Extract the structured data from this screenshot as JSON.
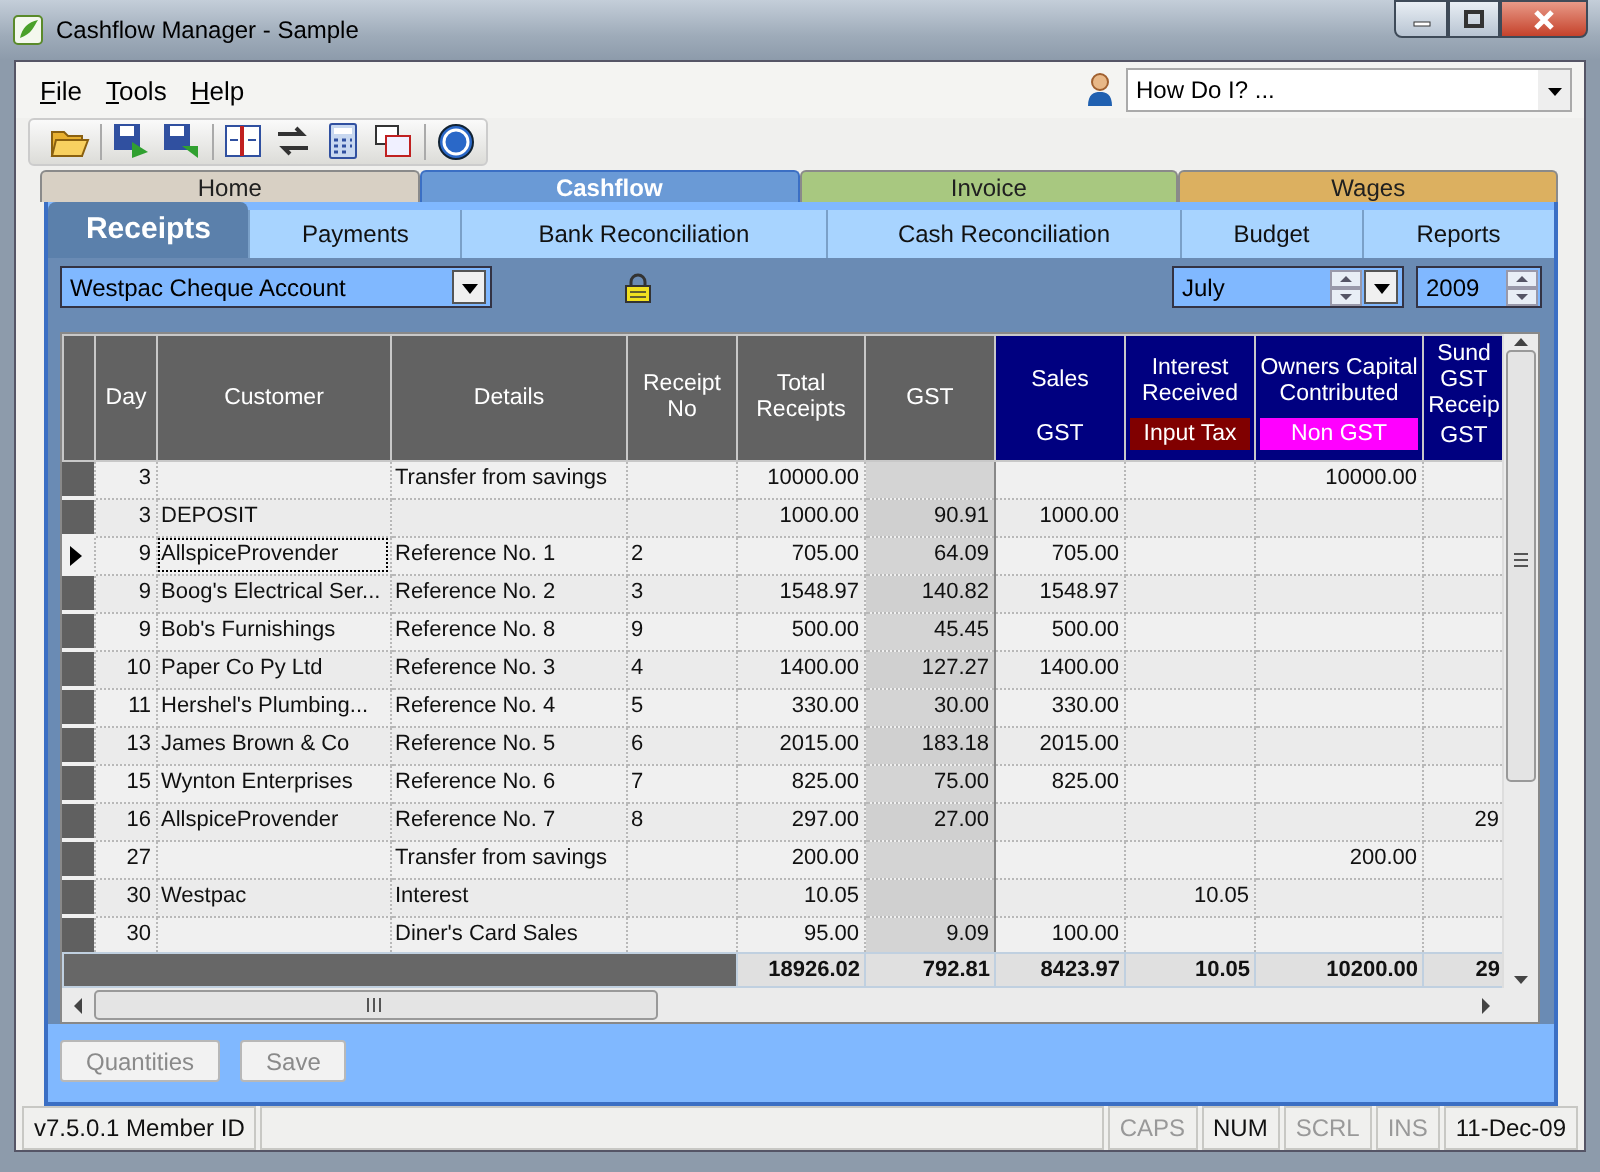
{
  "window": {
    "title": "Cashflow Manager - Sample",
    "menu": [
      "File",
      "Tools",
      "Help"
    ],
    "help_search": {
      "value": "How Do I? ..."
    }
  },
  "top_tabs": [
    {
      "label": "Home",
      "selected": false,
      "color": "#d8d0c4"
    },
    {
      "label": "Cashflow",
      "selected": true,
      "color": "#6a9ad6"
    },
    {
      "label": "Invoice",
      "selected": false,
      "color": "#a8c880"
    },
    {
      "label": "Wages",
      "selected": false,
      "color": "#dcb060"
    }
  ],
  "sub_tabs": [
    {
      "label": "Receipts",
      "selected": true
    },
    {
      "label": "Payments",
      "selected": false
    },
    {
      "label": "Bank Reconciliation",
      "selected": false
    },
    {
      "label": "Cash Reconciliation",
      "selected": false
    },
    {
      "label": "Budget",
      "selected": false
    },
    {
      "label": "Reports",
      "selected": false
    }
  ],
  "filters": {
    "account": "Westpac Cheque Account",
    "locked": true,
    "month": "July",
    "year": "2009"
  },
  "columns": [
    {
      "header": "Day",
      "kind": "day"
    },
    {
      "header": "Customer",
      "kind": "text"
    },
    {
      "header": "Details",
      "kind": "text"
    },
    {
      "header": "Receipt No",
      "kind": "text"
    },
    {
      "header": "Total Receipts",
      "kind": "amount"
    },
    {
      "header": "GST",
      "kind": "computed"
    },
    {
      "header": "Sales",
      "kind": "account",
      "tag": "GST"
    },
    {
      "header": "Interest Received",
      "kind": "account",
      "tag": "Input Tax",
      "color": "#800000"
    },
    {
      "header": "Owners Capital Contributed",
      "kind": "account",
      "tag": "Non GST",
      "color": "#ff00ff"
    },
    {
      "header": "Sund GST Receip",
      "kind": "account",
      "tag": "GST"
    }
  ],
  "rows": [
    {
      "selected": false,
      "cells": [
        "3",
        "",
        "Transfer from savings",
        "",
        "10000.00",
        "",
        "",
        "",
        "10000.00",
        ""
      ]
    },
    {
      "selected": false,
      "cells": [
        "3",
        "DEPOSIT",
        "",
        "",
        "1000.00",
        "90.91",
        "1000.00",
        "",
        "",
        ""
      ]
    },
    {
      "selected": true,
      "cells": [
        "9",
        "AllspiceProvender",
        "Reference No. 1",
        "2",
        "705.00",
        "64.09",
        "705.00",
        "",
        "",
        ""
      ]
    },
    {
      "selected": false,
      "cells": [
        "9",
        "Boog's Electrical Ser...",
        "Reference No. 2",
        "3",
        "1548.97",
        "140.82",
        "1548.97",
        "",
        "",
        ""
      ]
    },
    {
      "selected": false,
      "cells": [
        "9",
        "Bob's Furnishings",
        "Reference No. 8",
        "9",
        "500.00",
        "45.45",
        "500.00",
        "",
        "",
        ""
      ]
    },
    {
      "selected": false,
      "cells": [
        "10",
        "Paper Co Py Ltd",
        "Reference No. 3",
        "4",
        "1400.00",
        "127.27",
        "1400.00",
        "",
        "",
        ""
      ]
    },
    {
      "selected": false,
      "cells": [
        "11",
        "Hershel's Plumbing...",
        "Reference No. 4",
        "5",
        "330.00",
        "30.00",
        "330.00",
        "",
        "",
        ""
      ]
    },
    {
      "selected": false,
      "cells": [
        "13",
        "James Brown & Co",
        "Reference No. 5",
        "6",
        "2015.00",
        "183.18",
        "2015.00",
        "",
        "",
        ""
      ]
    },
    {
      "selected": false,
      "cells": [
        "15",
        "Wynton Enterprises",
        "Reference No. 6",
        "7",
        "825.00",
        "75.00",
        "825.00",
        "",
        "",
        ""
      ]
    },
    {
      "selected": false,
      "cells": [
        "16",
        "AllspiceProvender",
        "Reference No. 7",
        "8",
        "297.00",
        "27.00",
        "",
        "",
        "",
        "29"
      ]
    },
    {
      "selected": false,
      "cells": [
        "27",
        "",
        "Transfer from savings",
        "",
        "200.00",
        "",
        "",
        "",
        "200.00",
        ""
      ]
    },
    {
      "selected": false,
      "cells": [
        "30",
        "Westpac",
        "Interest",
        "",
        "10.05",
        "",
        "",
        "10.05",
        "",
        ""
      ]
    },
    {
      "selected": false,
      "cells": [
        "30",
        "",
        "Diner's Card Sales",
        "",
        "95.00",
        "9.09",
        "100.00",
        "",
        "",
        ""
      ]
    }
  ],
  "totals": [
    "18926.02",
    "792.81",
    "8423.97",
    "10.05",
    "10200.00",
    "29"
  ],
  "buttons": [
    {
      "label": "Quantities",
      "disabled": true
    },
    {
      "label": "Save",
      "disabled": true
    }
  ],
  "status_bar": {
    "version": "v7.5.0.1 Member ID",
    "indicators": [
      {
        "label": "CAPS",
        "on": false
      },
      {
        "label": "NUM",
        "on": true
      },
      {
        "label": "SCRL",
        "on": false
      },
      {
        "label": "INS",
        "on": false
      }
    ],
    "date": "11-Dec-09"
  }
}
